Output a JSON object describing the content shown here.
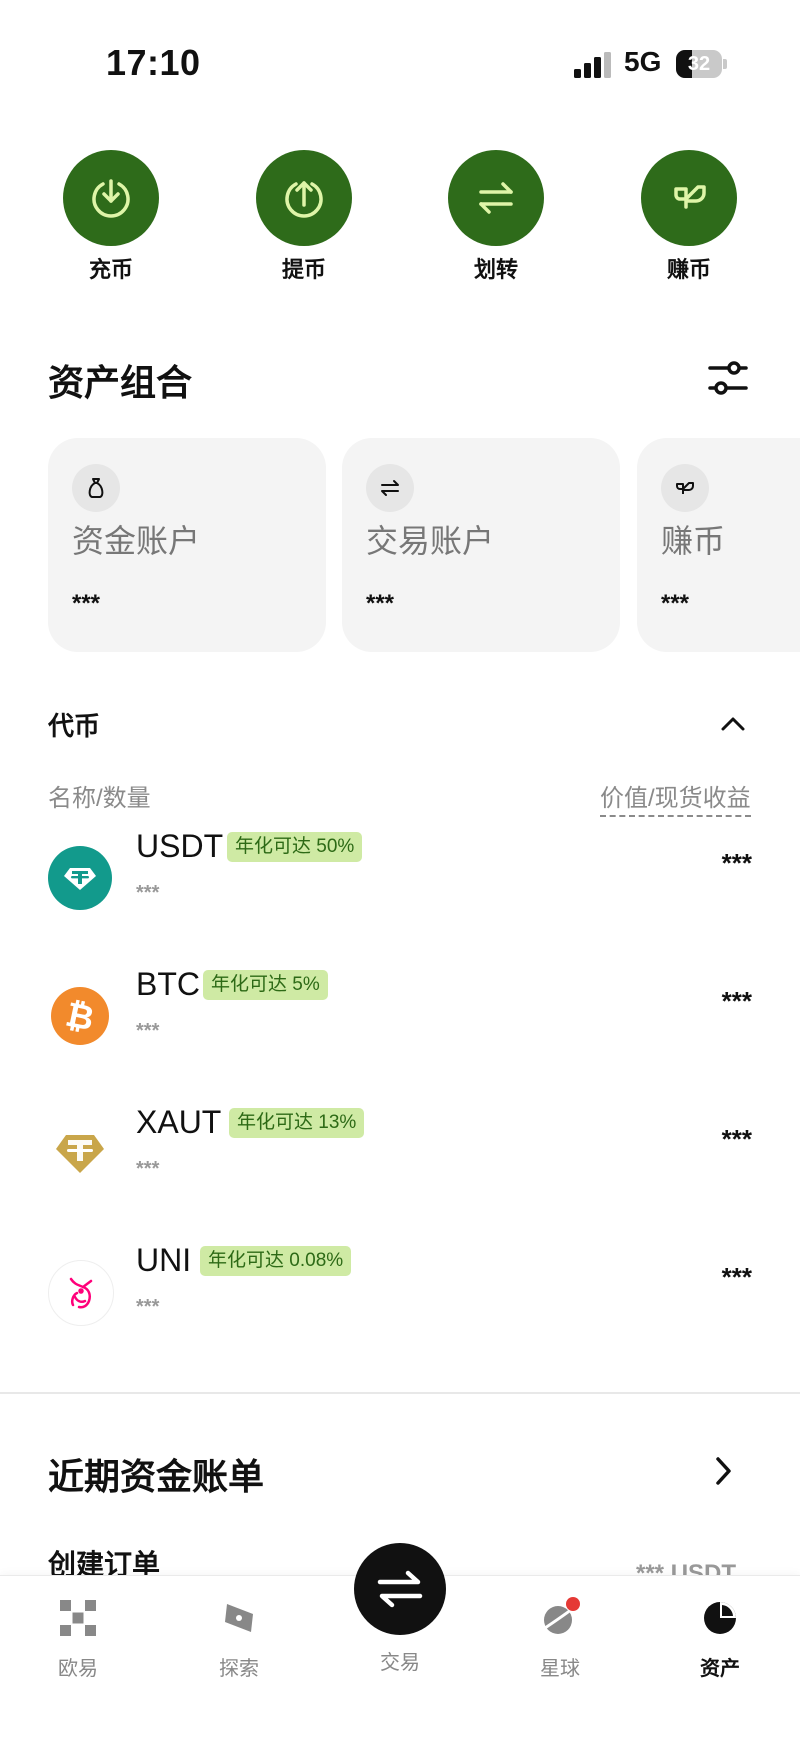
{
  "status_bar": {
    "time": "17:10",
    "network": "5G",
    "battery": "32"
  },
  "quick_actions": [
    {
      "label": "充币",
      "icon": "deposit-icon"
    },
    {
      "label": "提币",
      "icon": "withdraw-icon"
    },
    {
      "label": "划转",
      "icon": "transfer-icon"
    },
    {
      "label": "赚币",
      "icon": "earn-icon"
    }
  ],
  "portfolio": {
    "title": "资产组合",
    "cards": [
      {
        "title": "资金账户",
        "value": "***",
        "icon": "money-bag-icon"
      },
      {
        "title": "交易账户",
        "value": "***",
        "icon": "exchange-icon"
      },
      {
        "title": "赚币",
        "value": "***",
        "icon": "sprout-icon"
      }
    ]
  },
  "tokens": {
    "title": "代币",
    "header_left": "名称/数量",
    "header_right": "价值/现货收益",
    "items": [
      {
        "symbol": "USDT",
        "badge": "年化可达 50%",
        "qty": "***",
        "value": "***",
        "icon": "usdt-icon",
        "color": "#129a8c"
      },
      {
        "symbol": "BTC",
        "badge": "年化可达 5%",
        "qty": "***",
        "value": "***",
        "icon": "btc-icon",
        "color": "#f28a2c"
      },
      {
        "symbol": "XAUT",
        "badge": "年化可达 13%",
        "qty": "***",
        "value": "***",
        "icon": "xaut-icon",
        "color": "#c9a64a"
      },
      {
        "symbol": "UNI",
        "badge": "年化可达 0.08%",
        "qty": "***",
        "value": "***",
        "icon": "uni-icon",
        "color": "#ff007a"
      }
    ]
  },
  "bills": {
    "title": "近期资金账单",
    "first_item_label": "创建订单",
    "first_item_value": "*** USDT"
  },
  "bottom_nav": [
    {
      "label": "欧易",
      "icon": "okx-logo-icon"
    },
    {
      "label": "探索",
      "icon": "compass-icon"
    },
    {
      "label": "交易",
      "icon": "trade-icon"
    },
    {
      "label": "星球",
      "icon": "planet-icon"
    },
    {
      "label": "资产",
      "icon": "pie-chart-icon"
    }
  ],
  "colors": {
    "accent_green": "#2e6b1a",
    "badge_bg": "#cfeaa4",
    "badge_text": "#2d6a16"
  }
}
